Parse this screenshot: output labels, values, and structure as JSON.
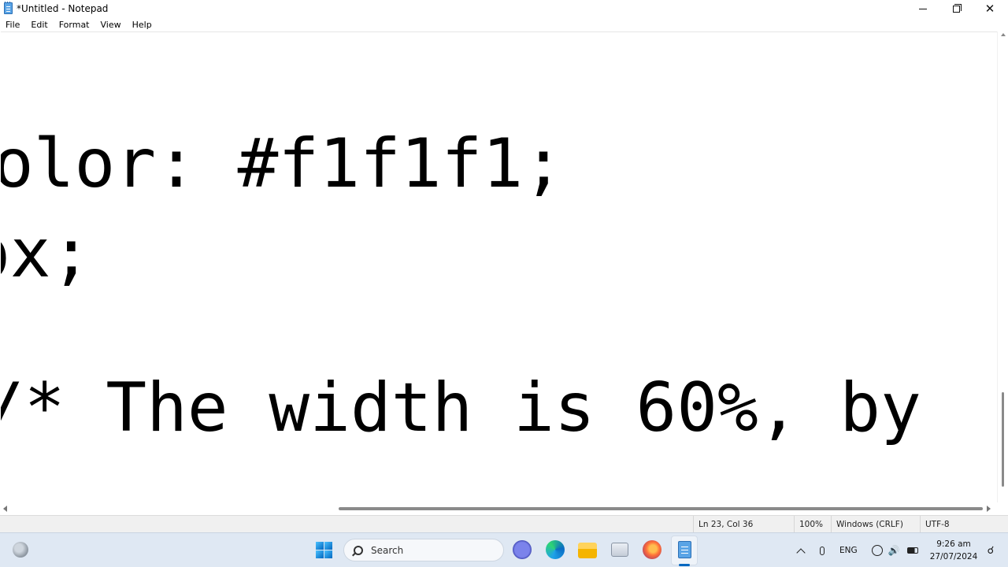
{
  "window": {
    "title": "*Untitled - Notepad",
    "controls": {
      "minimize": "minimize",
      "maximize": "maximize",
      "close": "✕"
    }
  },
  "menu": {
    "items": [
      "File",
      "Edit",
      "Format",
      "View",
      "Help"
    ]
  },
  "editor": {
    "lines": [
      "olor: #f1f1f1;",
      "px;",
      "/* The width is 60%, by"
    ]
  },
  "statusbar": {
    "position": "Ln 23, Col 36",
    "zoom": "100%",
    "line_ending": "Windows (CRLF)",
    "encoding": "UTF-8"
  },
  "taskbar": {
    "search_label": "Search",
    "apps": [
      "widgets-icon",
      "start-icon",
      "meet-icon",
      "edge-icon",
      "file-explorer-icon",
      "snipping-tool-icon",
      "firefox-icon",
      "notepad-icon"
    ],
    "tray": {
      "language": "ENG",
      "time": "9:26 am",
      "date": "27/07/2024"
    }
  }
}
